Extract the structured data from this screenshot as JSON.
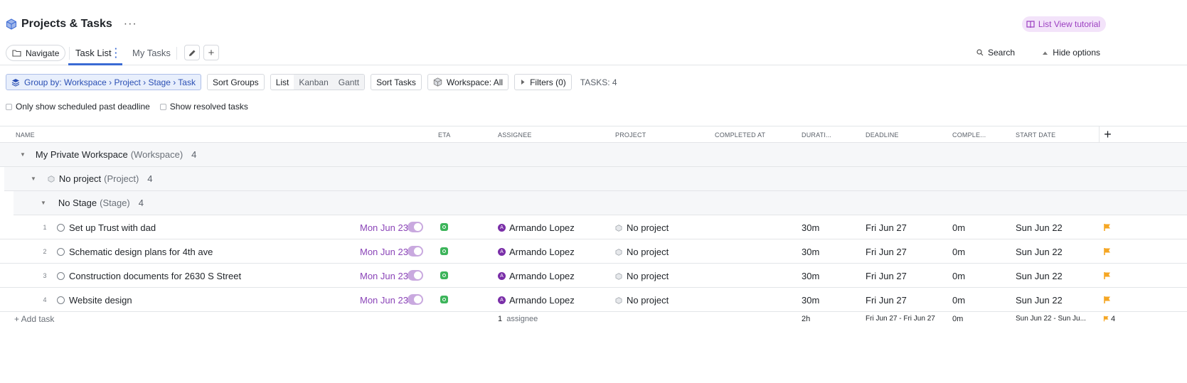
{
  "header": {
    "title": "Projects & Tasks",
    "more": "···",
    "tutorial": "List View tutorial"
  },
  "tabs": {
    "navigate": "Navigate",
    "task_list": "Task List",
    "my_tasks": "My Tasks",
    "search": "Search",
    "hide_options": "Hide options"
  },
  "toolbar": {
    "group_by": "Group by: Workspace › Project › Stage › Task",
    "sort_groups": "Sort Groups",
    "views": [
      "List",
      "Kanban",
      "Gantt"
    ],
    "sort_tasks": "Sort Tasks",
    "workspace": "Workspace: All",
    "filters": "Filters (0)",
    "task_count": "TASKS: 4"
  },
  "checkboxes": {
    "past_deadline": "Only show scheduled past deadline",
    "resolved": "Show resolved tasks"
  },
  "columns": {
    "name": "NAME",
    "eta": "ETA",
    "assignee": "ASSIGNEE",
    "project": "PROJECT",
    "completed_at": "COMPLETED AT",
    "duration": "DURATI...",
    "deadline": "DEADLINE",
    "completed": "COMPLE...",
    "start_date": "START DATE",
    "add": "+"
  },
  "groups": {
    "workspace": {
      "name": "My Private Workspace",
      "type": "(Workspace)",
      "count": "4"
    },
    "project": {
      "name": "No project",
      "type": "(Project)",
      "count": "4"
    },
    "stage": {
      "name": "No Stage",
      "type": "(Stage)",
      "count": "4"
    }
  },
  "tasks": [
    {
      "num": "1",
      "name": "Set up Trust with dad",
      "eta": "Mon Jun 23",
      "assignee": "Armando Lopez",
      "avatar": "A",
      "project": "No project",
      "duration": "30m",
      "deadline": "Fri Jun 27",
      "completed": "0m",
      "start": "Sun Jun 22"
    },
    {
      "num": "2",
      "name": "Schematic design plans for 4th ave",
      "eta": "Mon Jun 23",
      "assignee": "Armando Lopez",
      "avatar": "A",
      "project": "No project",
      "duration": "30m",
      "deadline": "Fri Jun 27",
      "completed": "0m",
      "start": "Sun Jun 22"
    },
    {
      "num": "3",
      "name": "Construction documents for 2630 S Street",
      "eta": "Mon Jun 23",
      "assignee": "Armando Lopez",
      "avatar": "A",
      "project": "No project",
      "duration": "30m",
      "deadline": "Fri Jun 27",
      "completed": "0m",
      "start": "Sun Jun 22"
    },
    {
      "num": "4",
      "name": "Website design",
      "eta": "Mon Jun 23",
      "assignee": "Armando Lopez",
      "avatar": "A",
      "project": "No project",
      "duration": "30m",
      "deadline": "Fri Jun 27",
      "completed": "0m",
      "start": "Sun Jun 22"
    }
  ],
  "footer": {
    "add_task": "+ Add task",
    "assignee_count": "1",
    "assignee_label": "assignee",
    "duration_total": "2h",
    "deadline_range": "Fri Jun 27 - Fri Jun 27",
    "completed_total": "0m",
    "start_range": "Sun Jun 22 - Sun Ju...",
    "flag_count": "4"
  },
  "colors": {
    "accent": "#3a6ad4",
    "eta": "#8b45b8",
    "avatar": "#7a2fa8",
    "flag": "#f5a623",
    "status_green": "#3cb45a"
  }
}
